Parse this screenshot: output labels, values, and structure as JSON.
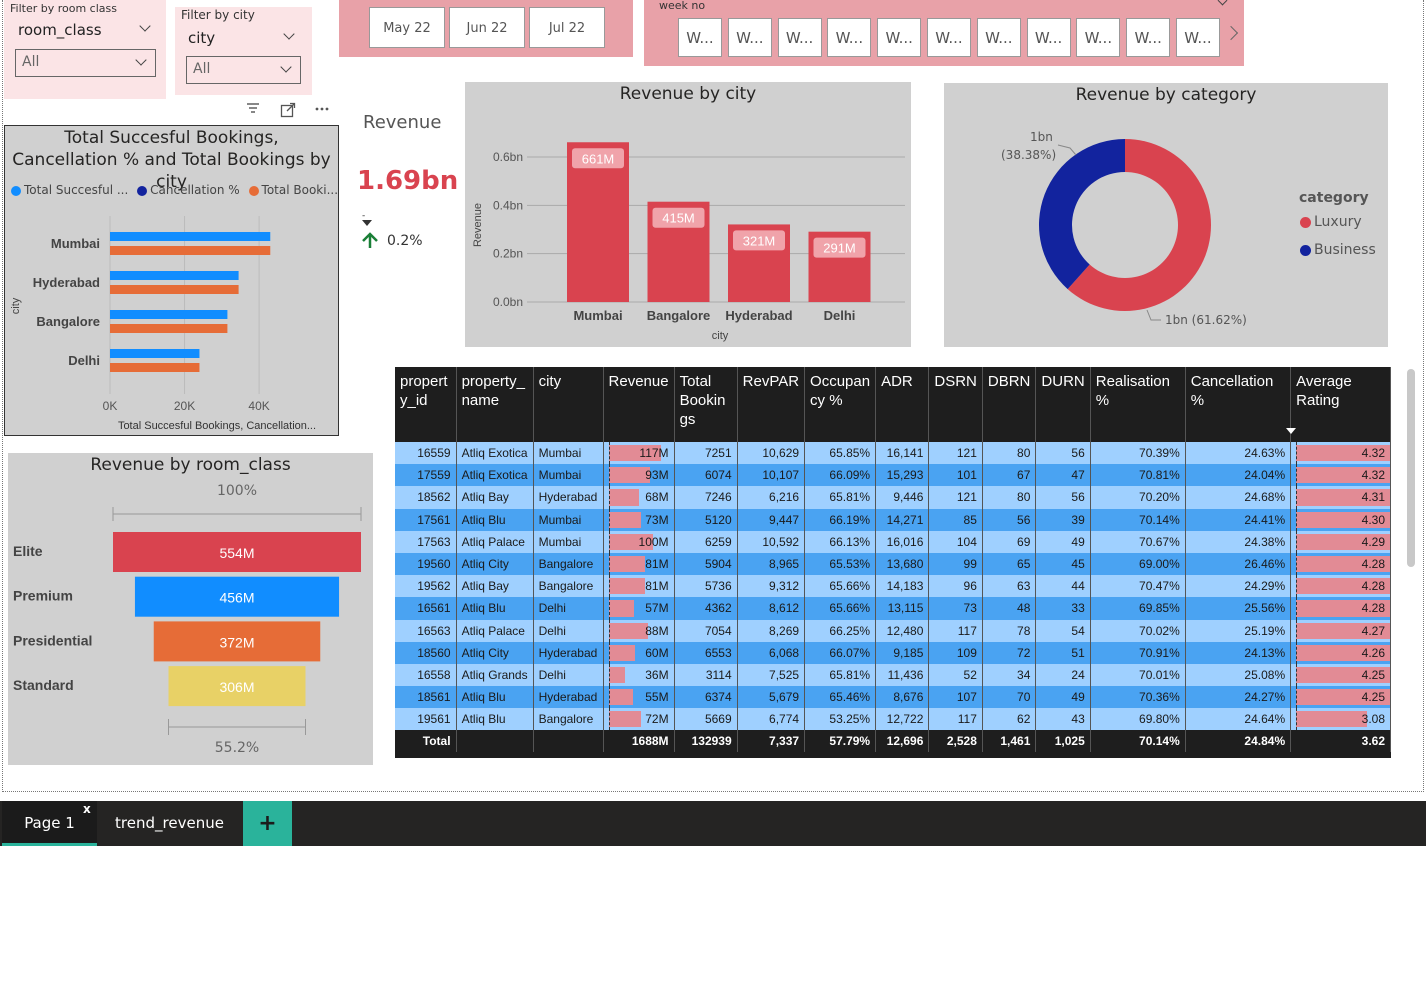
{
  "filters": {
    "room_class": {
      "heading": "Filter by room class",
      "field": "room_class",
      "value": "All"
    },
    "city": {
      "heading": "Filter by city",
      "field": "city",
      "value": "All"
    }
  },
  "months": [
    "May 22",
    "Jun 22",
    "Jul 22"
  ],
  "week_slicer": {
    "heading": "week no",
    "items": [
      "W...",
      "W...",
      "W...",
      "W...",
      "W...",
      "W...",
      "W...",
      "W...",
      "W...",
      "W...",
      "W..."
    ]
  },
  "kpi": {
    "title": "Revenue",
    "value": "1.69bn",
    "goal_marker": "-",
    "change": "0.2%"
  },
  "colors": {
    "red": "#d9434f",
    "blue": "#118dff",
    "navy": "#12239e",
    "orange": "#e66c37",
    "yellow": "#e8d166",
    "pink": "#f0a3aa",
    "grey": "#d0d0d0"
  },
  "bookings_chart": {
    "title": "Total Succesful Bookings, Cancellation % and Total Bookings by city",
    "legend": [
      "Total Succesful ...",
      "Cancellation %",
      "Total Booki..."
    ],
    "y_axis_label": "city",
    "x_axis_label": "Total Succesful Bookings, Cancellation...",
    "x_ticks": [
      "0K",
      "20K",
      "40K"
    ],
    "chart_data": {
      "type": "bar",
      "orientation": "horizontal",
      "categories": [
        "Mumbai",
        "Hyderabad",
        "Bangalore",
        "Delhi"
      ],
      "series": [
        {
          "name": "Total Succesful ...",
          "values": [
            43000,
            34500,
            31500,
            24000
          ]
        },
        {
          "name": "Cancellation %",
          "values": [
            0.25,
            0.24,
            0.25,
            0.25
          ]
        },
        {
          "name": "Total Booki...",
          "values": [
            43000,
            34500,
            31500,
            24000
          ]
        }
      ],
      "xlim": [
        0,
        55000
      ]
    }
  },
  "city_chart": {
    "title": "Revenue by city",
    "ylabel": "Revenue",
    "xlabel": "city",
    "y_ticks": [
      "0.6bn",
      "0.4bn",
      "0.2bn",
      "0.0bn"
    ],
    "chart_data": {
      "type": "bar",
      "categories": [
        "Mumbai",
        "Bangalore",
        "Hyderabad",
        "Delhi"
      ],
      "values": [
        661,
        415,
        321,
        291
      ],
      "data_labels": [
        "661M",
        "415M",
        "321M",
        "291M"
      ],
      "unit": "M",
      "ylim": [
        0,
        700
      ]
    }
  },
  "category_chart": {
    "title": "Revenue by category",
    "legend_title": "category",
    "labels": [
      "1bn (61.62%)",
      "1bn",
      "(38.38%)"
    ],
    "chart_data": {
      "type": "pie",
      "categories": [
        "Luxury",
        "Business"
      ],
      "values": [
        61.62,
        38.38
      ]
    }
  },
  "room_class_chart": {
    "title": "Revenue by room_class",
    "top_label": "100%",
    "bottom_label": "55.2%",
    "chart_data": {
      "type": "bar",
      "style": "funnel",
      "categories": [
        "Elite",
        "Premium",
        "Presidential",
        "Standard"
      ],
      "values": [
        554,
        456,
        372,
        306
      ],
      "data_labels": [
        "554M",
        "456M",
        "372M",
        "306M"
      ]
    }
  },
  "table": {
    "headers": [
      "propert y_id",
      "property_ name",
      "city",
      "Revenue",
      "Total Bookin gs",
      "RevPAR",
      "Occupan cy %",
      "ADR",
      "DSRN",
      "DBRN",
      "DURN",
      "Realisation %",
      "Cancellation %",
      "Average Rating"
    ],
    "rows": [
      [
        "16559",
        "Atliq Exotica",
        "Mumbai",
        "117M",
        "7251",
        "10,629",
        "65.85%",
        "16,141",
        "121",
        "80",
        "56",
        "70.39%",
        "24.63%",
        "4.32"
      ],
      [
        "17559",
        "Atliq Exotica",
        "Mumbai",
        "93M",
        "6074",
        "10,107",
        "66.09%",
        "15,293",
        "101",
        "67",
        "47",
        "70.81%",
        "24.04%",
        "4.32"
      ],
      [
        "18562",
        "Atliq Bay",
        "Hyderabad",
        "68M",
        "7246",
        "6,216",
        "65.81%",
        "9,446",
        "121",
        "80",
        "56",
        "70.20%",
        "24.68%",
        "4.31"
      ],
      [
        "17561",
        "Atliq Blu",
        "Mumbai",
        "73M",
        "5120",
        "9,447",
        "66.19%",
        "14,271",
        "85",
        "56",
        "39",
        "70.14%",
        "24.41%",
        "4.30"
      ],
      [
        "17563",
        "Atliq Palace",
        "Mumbai",
        "100M",
        "6259",
        "10,592",
        "66.13%",
        "16,016",
        "104",
        "69",
        "49",
        "70.67%",
        "24.38%",
        "4.29"
      ],
      [
        "19560",
        "Atliq City",
        "Bangalore",
        "81M",
        "5904",
        "8,965",
        "65.53%",
        "13,680",
        "99",
        "65",
        "45",
        "69.00%",
        "26.46%",
        "4.28"
      ],
      [
        "19562",
        "Atliq Bay",
        "Bangalore",
        "81M",
        "5736",
        "9,312",
        "65.66%",
        "14,183",
        "96",
        "63",
        "44",
        "70.47%",
        "24.29%",
        "4.28"
      ],
      [
        "16561",
        "Atliq Blu",
        "Delhi",
        "57M",
        "4362",
        "8,612",
        "65.66%",
        "13,115",
        "73",
        "48",
        "33",
        "69.85%",
        "25.56%",
        "4.28"
      ],
      [
        "16563",
        "Atliq Palace",
        "Delhi",
        "88M",
        "7054",
        "8,269",
        "66.25%",
        "12,480",
        "117",
        "78",
        "54",
        "70.02%",
        "25.19%",
        "4.27"
      ],
      [
        "18560",
        "Atliq City",
        "Hyderabad",
        "60M",
        "6553",
        "6,068",
        "66.07%",
        "9,185",
        "109",
        "72",
        "51",
        "70.91%",
        "24.13%",
        "4.26"
      ],
      [
        "16558",
        "Atliq Grands",
        "Delhi",
        "36M",
        "3114",
        "7,525",
        "65.81%",
        "11,436",
        "52",
        "34",
        "24",
        "70.01%",
        "25.08%",
        "4.25"
      ],
      [
        "18561",
        "Atliq Blu",
        "Hyderabad",
        "55M",
        "6374",
        "5,679",
        "65.46%",
        "8,676",
        "107",
        "70",
        "49",
        "70.36%",
        "24.27%",
        "4.25"
      ],
      [
        "19561",
        "Atliq Blu",
        "Bangalore",
        "72M",
        "5669",
        "6,774",
        "53.25%",
        "12,722",
        "117",
        "62",
        "43",
        "69.80%",
        "24.64%",
        "3.08"
      ]
    ],
    "revenue_values": [
      117,
      93,
      68,
      73,
      100,
      81,
      81,
      57,
      88,
      60,
      36,
      55,
      72
    ],
    "rating_values": [
      4.32,
      4.32,
      4.31,
      4.3,
      4.29,
      4.28,
      4.28,
      4.28,
      4.27,
      4.26,
      4.25,
      4.25,
      3.08
    ],
    "total": [
      "Total",
      "",
      "",
      "1688M",
      "132939",
      "7,337",
      "57.79%",
      "12,696",
      "2,528",
      "1,461",
      "1,025",
      "70.14%",
      "24.84%",
      "3.62"
    ]
  },
  "tabs": {
    "page1": "Page 1",
    "page1_close": "x",
    "trend": "trend_revenue",
    "add": "+"
  }
}
